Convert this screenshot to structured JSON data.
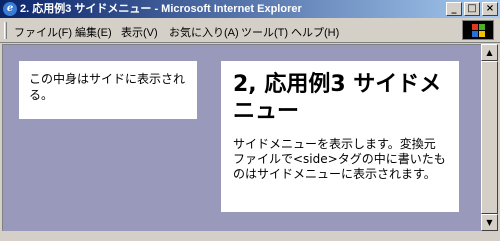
{
  "window": {
    "title": "2. 応用例3 サイドメニュー - Microsoft Internet Explorer"
  },
  "menubar": {
    "items": [
      {
        "label": "ファイル(F)"
      },
      {
        "label": "編集(E)"
      },
      {
        "label": "表示(V)"
      },
      {
        "label": "お気に入り(A)"
      },
      {
        "label": "ツール(T)"
      },
      {
        "label": "ヘルプ(H)"
      }
    ]
  },
  "page": {
    "side_text": "この中身はサイドに表示される。",
    "heading": "2, 応用例3 サイドメニュー",
    "body_text": "サイドメニューを表示します。変換元ファイルで<side>タグの中に書いたものはサイドメニューに表示されます。"
  },
  "colors": {
    "background": "#9999bb",
    "titlebar_start": "#0a246a",
    "titlebar_end": "#a6caf0"
  }
}
